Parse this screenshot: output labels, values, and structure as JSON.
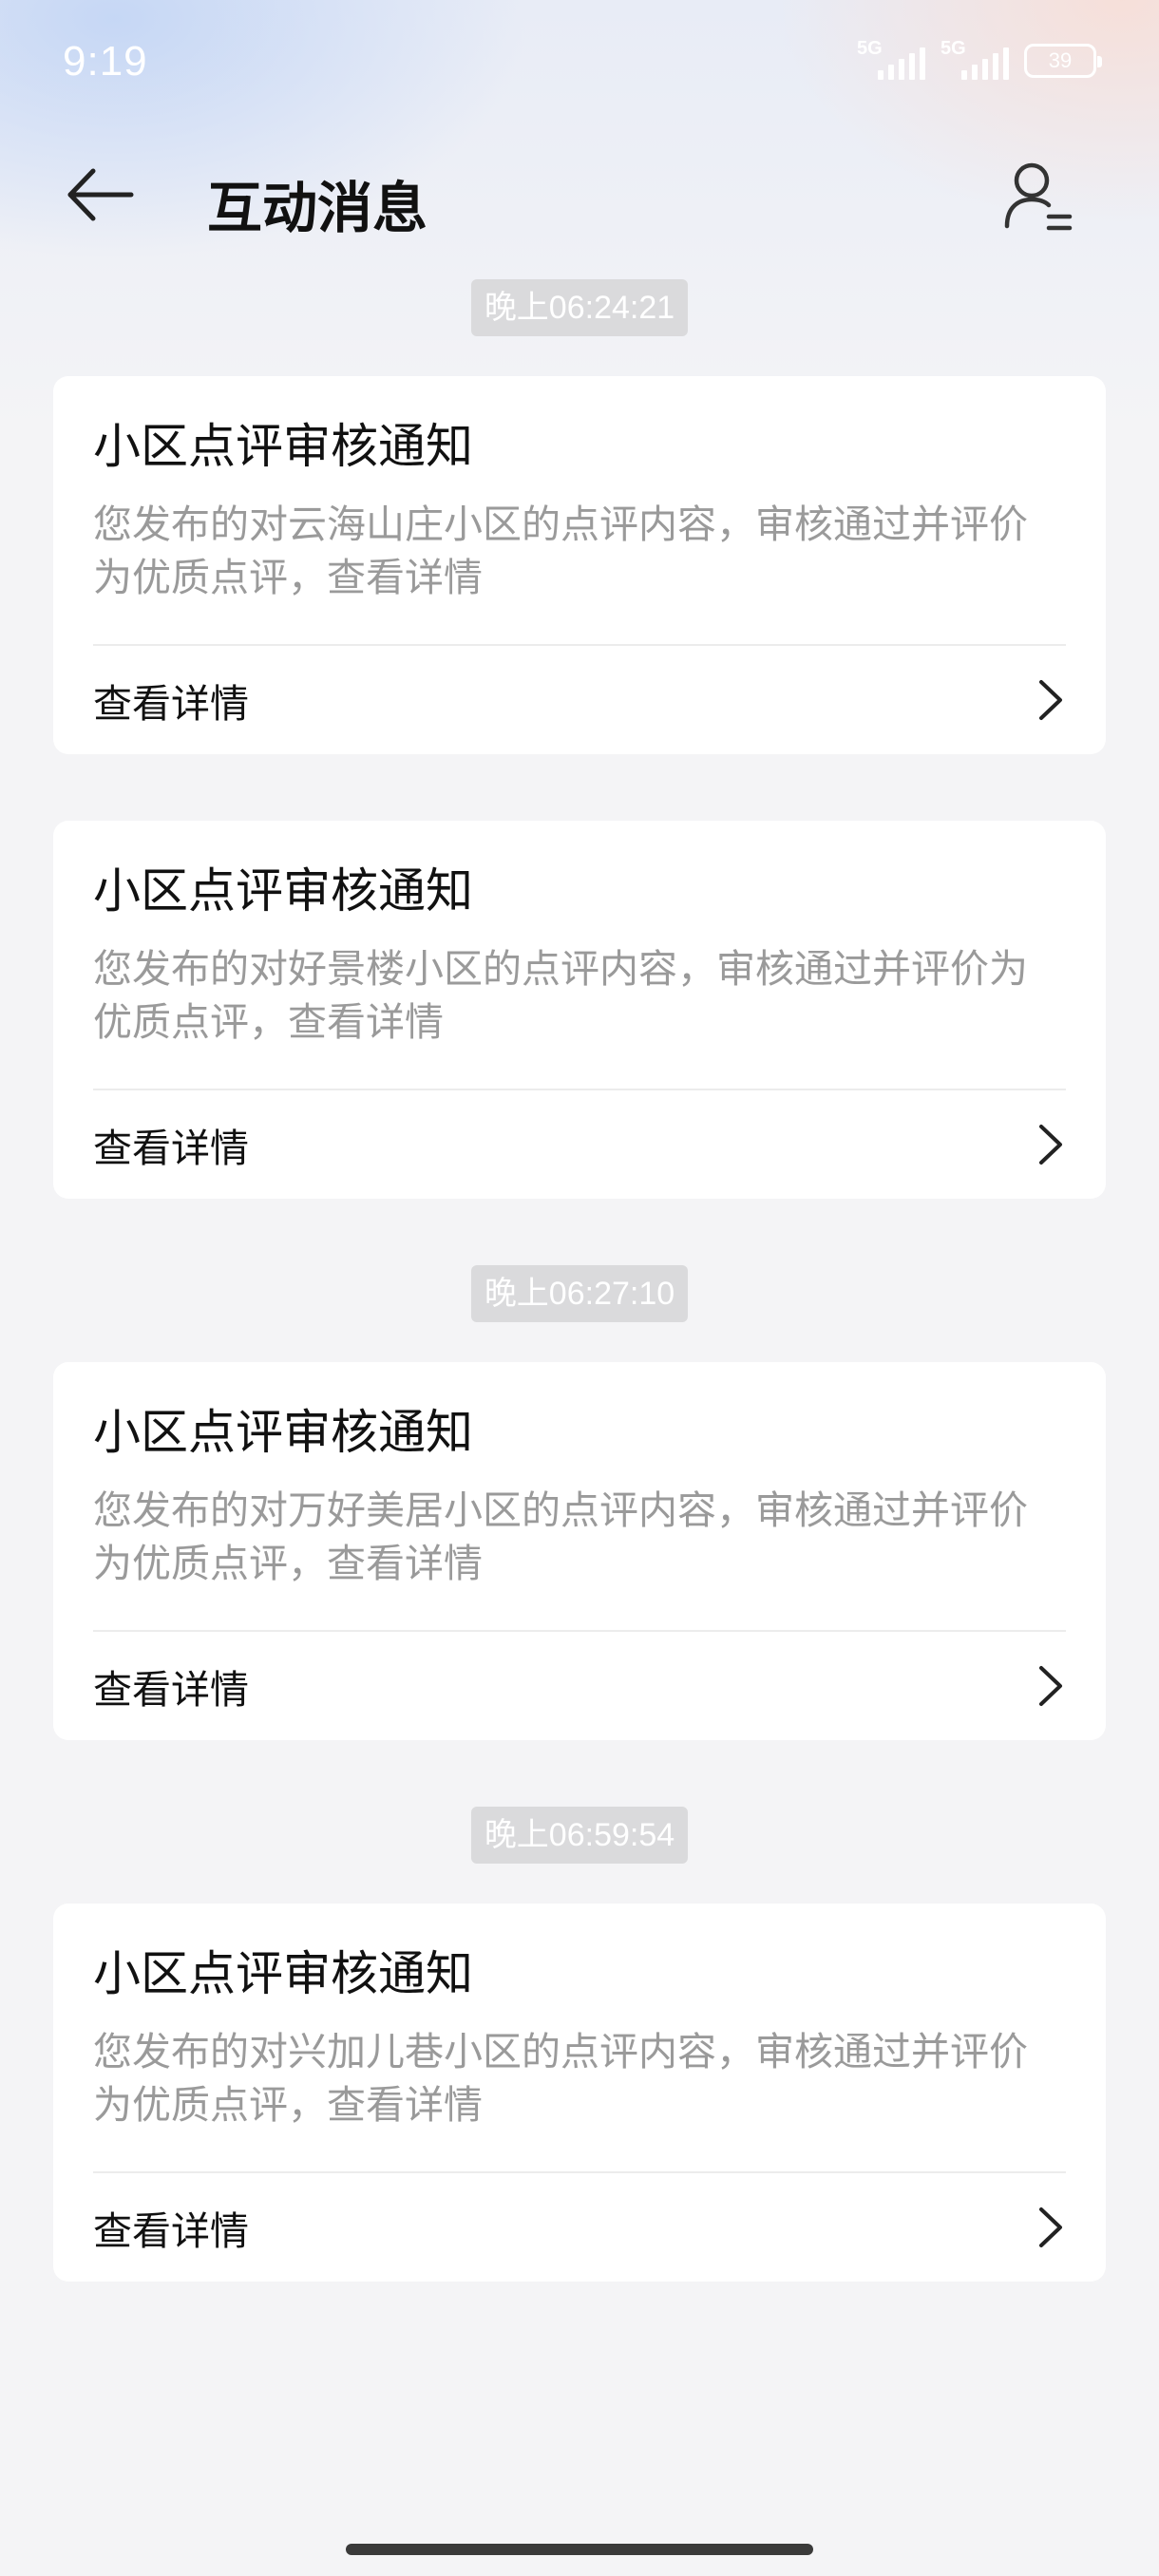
{
  "status_bar": {
    "time": "9:19",
    "signal_1": "5G",
    "signal_2": "5G",
    "battery": "39"
  },
  "header": {
    "title": "互动消息",
    "back_icon": "arrow-left-icon",
    "profile_icon": "user-menu-icon"
  },
  "groups": [
    {
      "time": "晚上06:24:21",
      "cards": [
        {
          "title": "小区点评审核通知",
          "body": "您发布的对云海山庄小区的点评内容，审核通过并评价为优质点评，查看详情",
          "link": "查看详情"
        },
        {
          "title": "小区点评审核通知",
          "body": "您发布的对好景楼小区的点评内容，审核通过并评价为优质点评，查看详情",
          "link": "查看详情"
        }
      ]
    },
    {
      "time": "晚上06:27:10",
      "cards": [
        {
          "title": "小区点评审核通知",
          "body": "您发布的对万好美居小区的点评内容，审核通过并评价为优质点评，查看详情",
          "link": "查看详情"
        }
      ]
    },
    {
      "time": "晚上06:59:54",
      "cards": [
        {
          "title": "小区点评审核通知",
          "body": "您发布的对兴加儿巷小区的点评内容，审核通过并评价为优质点评，查看详情",
          "link": "查看详情"
        }
      ]
    }
  ],
  "colors": {
    "background": "#f4f4f6",
    "card": "#ffffff",
    "title_text": "#111111",
    "body_text": "#9a9a9a",
    "time_pill": "#dadadc"
  }
}
